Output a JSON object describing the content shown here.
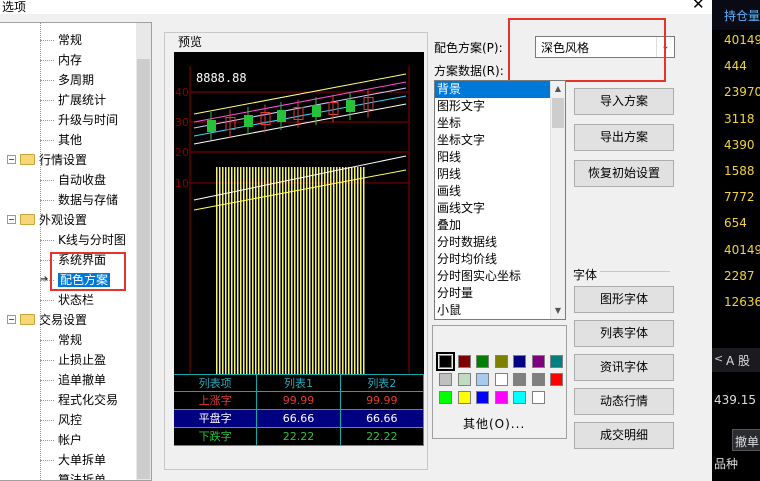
{
  "window": {
    "title": "选项",
    "close_symbol": "✕"
  },
  "tree": {
    "items": [
      {
        "label": "常规",
        "kind": "leaf"
      },
      {
        "label": "内存",
        "kind": "leaf"
      },
      {
        "label": "多周期",
        "kind": "leaf"
      },
      {
        "label": "扩展统计",
        "kind": "leaf"
      },
      {
        "label": "升级与时间",
        "kind": "leaf"
      },
      {
        "label": "其他",
        "kind": "leaf"
      },
      {
        "label": "行情设置",
        "kind": "group"
      },
      {
        "label": "自动收盘",
        "kind": "leaf"
      },
      {
        "label": "数据与存储",
        "kind": "leaf"
      },
      {
        "label": "外观设置",
        "kind": "group"
      },
      {
        "label": "K线与分时图",
        "kind": "leaf"
      },
      {
        "label": "系统界面",
        "kind": "leaf"
      },
      {
        "label": "配色方案",
        "kind": "leaf",
        "selected": true
      },
      {
        "label": "状态栏",
        "kind": "leaf"
      },
      {
        "label": "交易设置",
        "kind": "group"
      },
      {
        "label": "常规",
        "kind": "leaf"
      },
      {
        "label": "止损止盈",
        "kind": "leaf"
      },
      {
        "label": "追单撤单",
        "kind": "leaf"
      },
      {
        "label": "程式化交易",
        "kind": "leaf"
      },
      {
        "label": "风控",
        "kind": "leaf"
      },
      {
        "label": "帐户",
        "kind": "leaf"
      },
      {
        "label": "大单拆单",
        "kind": "leaf"
      },
      {
        "label": "算法拆单",
        "kind": "leaf"
      }
    ]
  },
  "preview": {
    "label": "预览",
    "price_readout": "8888.88",
    "axis_labels": [
      "40",
      "30",
      "20",
      "10"
    ],
    "colors": {
      "background": "#000000",
      "up": "#e03a3a",
      "down": "#27c23a",
      "volume": "#f2f07a",
      "grid": "#8b0000"
    },
    "table": {
      "headers": [
        "列表项",
        "列表1",
        "列表2"
      ],
      "rows": [
        [
          "上涨字",
          "99.99",
          "99.99"
        ],
        [
          "平盘字",
          "66.66",
          "66.66"
        ],
        [
          "下跌字",
          "22.22",
          "22.22"
        ]
      ]
    }
  },
  "scheme": {
    "label": "配色方案(P):",
    "selected": "深色风格",
    "data_label": "方案数据(R):",
    "items": [
      "背景",
      "图形文字",
      "坐标",
      "坐标文字",
      "阳线",
      "阴线",
      "画线",
      "画线文字",
      "叠加",
      "分时数据线",
      "分时均价线",
      "分时图实心坐标",
      "分时量",
      "小鼠"
    ]
  },
  "palette": {
    "colors": [
      "#000000",
      "#800000",
      "#008000",
      "#808000",
      "#000080",
      "#800080",
      "#008080",
      "#c0c0c0",
      "#c0dcc0",
      "#a6caf0",
      "#ffffff",
      "#808080",
      "#7f7f7f",
      "#ff0000",
      "#00ff00",
      "#ffff00",
      "#0000ff",
      "#ff00ff",
      "#00ffff",
      "#ffffff"
    ],
    "selected_index": 0,
    "other_label": "其他(O)..."
  },
  "buttons": {
    "import": "导入方案",
    "export": "导出方案",
    "reset": "恢复初始设置",
    "font_section": "字体",
    "graph_font": "图形字体",
    "list_font": "列表字体",
    "info_font": "资讯字体",
    "dynamic_quote": "动态行情",
    "trade_detail": "成交明细"
  },
  "right_panel": {
    "header": "持仓量",
    "values": [
      "40149",
      "444",
      "23970",
      "3118",
      "4390",
      "1588",
      "7772",
      "654",
      "40149",
      "2287",
      "12636"
    ],
    "section": "A 股",
    "price": "439.15",
    "undo_button": "撤单",
    "kind_label": "品种"
  }
}
